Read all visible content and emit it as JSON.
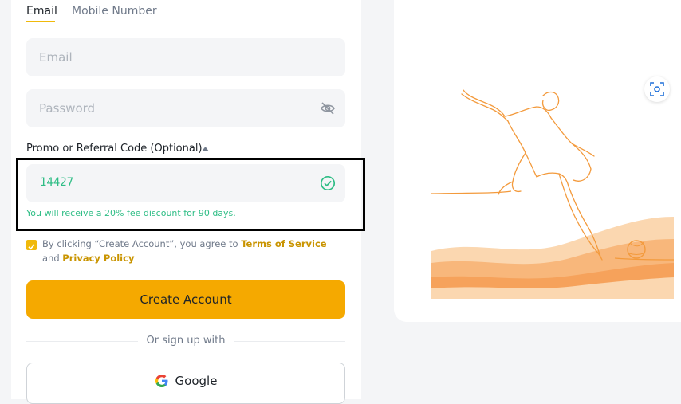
{
  "tabs": [
    {
      "label": "Email",
      "active": true
    },
    {
      "label": "Mobile Number",
      "active": false
    }
  ],
  "form": {
    "email_placeholder": "Email",
    "password_placeholder": "Password",
    "promo_label": "Promo or Referral Code (Optional)",
    "promo_value": "14427",
    "promo_message": "You will receive a 20% fee discount for 90 days.",
    "agree_prefix": "By clicking “Create Account”, you agree to",
    "terms_link": "Terms of Service",
    "agree_and": "and",
    "privacy_link": "Privacy Policy",
    "agree_checked": true,
    "create_button": "Create Account",
    "divider_text": "Or sign up with",
    "google_button": "Google"
  },
  "icons": {
    "password_toggle": "eye-slash-icon",
    "promo_status": "check-circle-icon",
    "promo_toggle": "caret-up-icon",
    "scan": "scan-qr-icon",
    "google": "google-logo-icon"
  },
  "colors": {
    "accent": "#f5a900",
    "link": "#c99400",
    "success": "#2ebd85",
    "illustration": "#f39a3c"
  }
}
